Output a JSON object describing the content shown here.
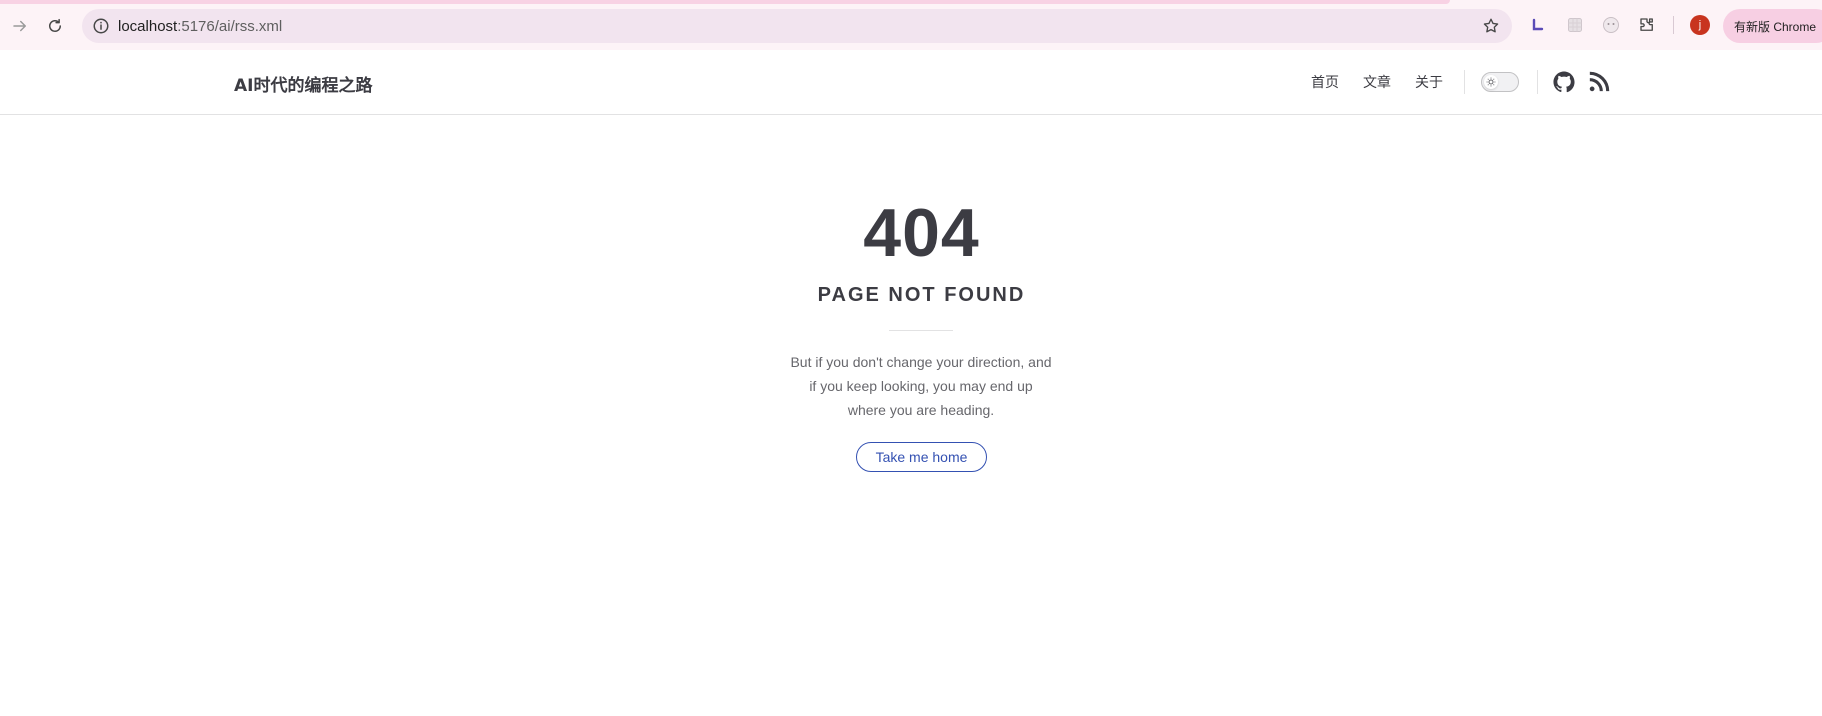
{
  "browser": {
    "url_host": "localhost",
    "url_path": ":5176/ai/rss.xml",
    "avatar_letter": "j",
    "update_label": "有新版 Chrome",
    "extension_icons": [
      "extension-l-icon",
      "extension-grid-icon",
      "extension-face-icon",
      "puzzle-icon"
    ]
  },
  "site": {
    "title": "AI时代的编程之路",
    "nav": [
      "首页",
      "文章",
      "关于"
    ],
    "appearance_switch": "light"
  },
  "not_found": {
    "code": "404",
    "title": "PAGE NOT FOUND",
    "quote": "But if you don't change your direction, and if you keep looking, you may end up where you are heading.",
    "button": "Take me home"
  },
  "colors": {
    "brand": "#3451b2",
    "text": "#3c3c43",
    "muted": "#67676c",
    "browser_bg": "#fdf3f7"
  }
}
